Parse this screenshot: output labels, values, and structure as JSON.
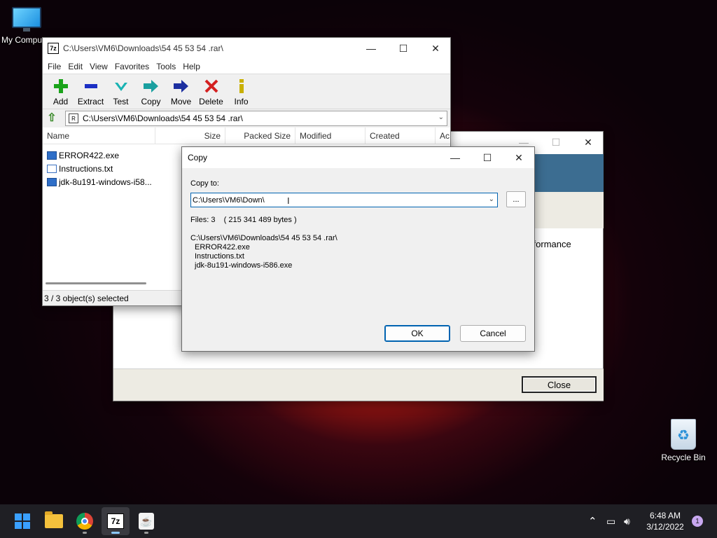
{
  "desktop": {
    "my_computer_label": "My Computer",
    "recycle_bin_label": "Recycle Bin"
  },
  "sevenzip": {
    "app_icon": "7z",
    "title": "C:\\Users\\VM6\\Downloads\\54 45 53 54 .rar\\",
    "menu": [
      "File",
      "Edit",
      "View",
      "Favorites",
      "Tools",
      "Help"
    ],
    "toolbar": [
      {
        "label": "Add",
        "icon": "plus-icon",
        "color": "#1aa31a"
      },
      {
        "label": "Extract",
        "icon": "minus-icon",
        "color": "#1c2fc4"
      },
      {
        "label": "Test",
        "icon": "check-icon",
        "color": "#1ab3b3"
      },
      {
        "label": "Copy",
        "icon": "double-arrow-icon",
        "color": "#1aa0a0"
      },
      {
        "label": "Move",
        "icon": "arrow-right-icon",
        "color": "#1c2fa0"
      },
      {
        "label": "Delete",
        "icon": "x-icon",
        "color": "#d42020"
      },
      {
        "label": "Info",
        "icon": "info-icon",
        "color": "#c9b000"
      }
    ],
    "address": "C:\\Users\\VM6\\Downloads\\54 45 53 54 .rar\\",
    "columns": [
      "Name",
      "Size",
      "Packed Size",
      "Modified",
      "Created",
      "Ac"
    ],
    "files": [
      {
        "name": "ERROR422.exe",
        "type": "exe"
      },
      {
        "name": "Instructions.txt",
        "type": "txt"
      },
      {
        "name": "jdk-8u191-windows-i58...",
        "type": "exe"
      }
    ],
    "status": "3 / 3 object(s) selected"
  },
  "background_window": {
    "performance_text": "erformance",
    "close_label": "Close"
  },
  "copy_dialog": {
    "title": "Copy",
    "copy_to_label": "Copy to:",
    "path_value": "C:\\Users\\VM6\\Down\\",
    "browse_label": "...",
    "files_info": "Files: 3    ( 215 341 489 bytes )",
    "source_path": "C:\\Users\\VM6\\Downloads\\54 45 53 54 .rar\\",
    "source_files": [
      "ERROR422.exe",
      "Instructions.txt",
      "jdk-8u191-windows-i586.exe"
    ],
    "ok_label": "OK",
    "cancel_label": "Cancel"
  },
  "taskbar": {
    "time": "6:48 AM",
    "date": "3/12/2022",
    "notification_count": "1",
    "apps": [
      "start-icon",
      "file-explorer-icon",
      "chrome-icon",
      "7zip-icon",
      "java-icon"
    ]
  }
}
